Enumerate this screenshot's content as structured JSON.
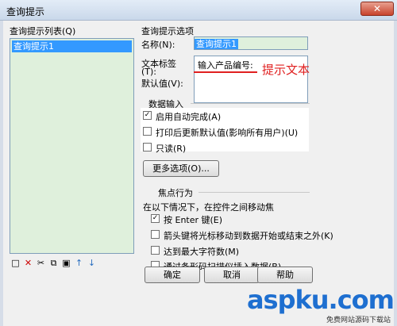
{
  "window": {
    "title": "查询提示",
    "close_icon": "close-icon"
  },
  "left": {
    "label": "查询提示列表(Q)",
    "items": [
      "查询提示1"
    ]
  },
  "toolbar": {
    "icons": [
      "new-icon",
      "delete-icon",
      "cut-icon",
      "copy-icon",
      "paste-icon",
      "move-up-icon",
      "move-down-icon"
    ]
  },
  "right": {
    "section_title": "查询提示选项",
    "name_label": "名称(N):",
    "name_value": "查询提示1",
    "text_label_line1": "文本标签",
    "text_label_line2": "(T):",
    "text_value": "输入产品编号:",
    "annotation": "提示文本",
    "default_label": "默认值(V):",
    "data_group": "数据输入",
    "autocomplete": "启用自动完成(A)",
    "refresh": "打印后更新默认值(影响所有用户)(U)",
    "readonly": "只读(R)",
    "more_btn": "更多选项(O)...",
    "focus_group": "焦点行为",
    "focus_desc": "在以下情况下，在控件之间移动焦",
    "opt_enter": "按 Enter 键(E)",
    "opt_arrow": "箭头键将光标移动到数据开始或结束之外(K)",
    "opt_max": "达到最大字符数(M)",
    "opt_barcode": "通过条形码扫描仪插入数据(B)"
  },
  "buttons": {
    "ok": "确定",
    "cancel": "取消",
    "help": "帮助"
  },
  "watermark": {
    "brand": "aspku.com",
    "sub": "免费网站源码下载站"
  }
}
